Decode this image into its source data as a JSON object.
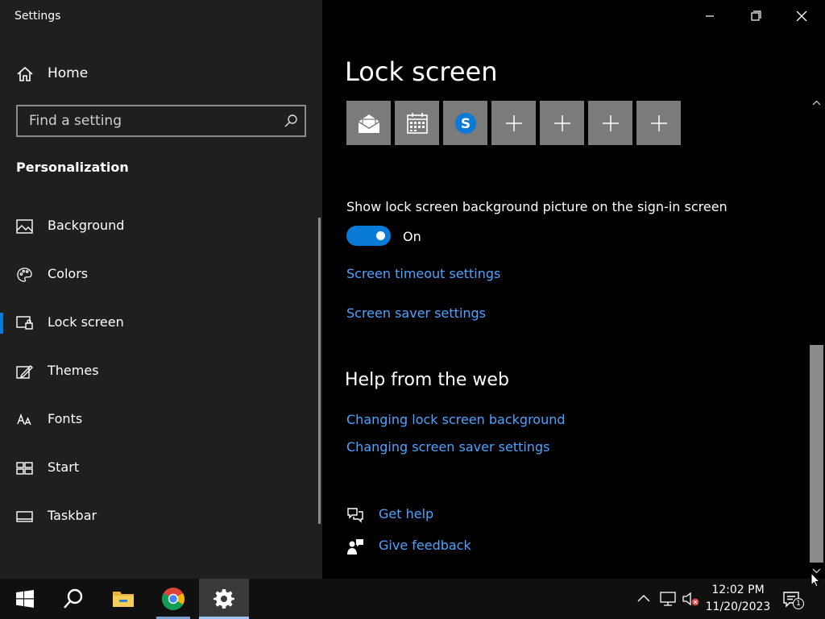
{
  "window": {
    "title": "Settings",
    "minimize_label": "",
    "maximize_label": "",
    "close_label": ""
  },
  "sidebar": {
    "home_label": "Home",
    "search_placeholder": "Find a setting",
    "section_title": "Personalization",
    "items": [
      {
        "label": "Background",
        "icon": "background-icon"
      },
      {
        "label": "Colors",
        "icon": "palette-icon"
      },
      {
        "label": "Lock screen",
        "icon": "lock-screen-icon",
        "active": true
      },
      {
        "label": "Themes",
        "icon": "themes-icon"
      },
      {
        "label": "Fonts",
        "icon": "fonts-icon"
      },
      {
        "label": "Start",
        "icon": "start-icon"
      },
      {
        "label": "Taskbar",
        "icon": "taskbar-icon"
      }
    ]
  },
  "main": {
    "page_title": "Lock screen",
    "quick_status_apps": [
      "mail",
      "calendar",
      "skype",
      "add",
      "add",
      "add",
      "add"
    ],
    "toggle_label": "Show lock screen background picture on the sign-in screen",
    "toggle_state": "On",
    "toggle_on": true,
    "links": [
      "Screen timeout settings",
      "Screen saver settings"
    ],
    "help_heading": "Help from the web",
    "help_links": [
      "Changing lock screen background",
      "Changing screen saver settings"
    ],
    "get_help": "Get help",
    "give_feedback": "Give feedback"
  },
  "taskbar": {
    "time": "12:02 PM",
    "date": "11/20/2023",
    "notification_count": "1"
  },
  "colors": {
    "accent": "#0a7ad8",
    "link": "#4ea3ff",
    "sidebar_bg": "#1f1f1f",
    "main_bg": "#000000",
    "tile_bg": "#7b7b7b"
  }
}
